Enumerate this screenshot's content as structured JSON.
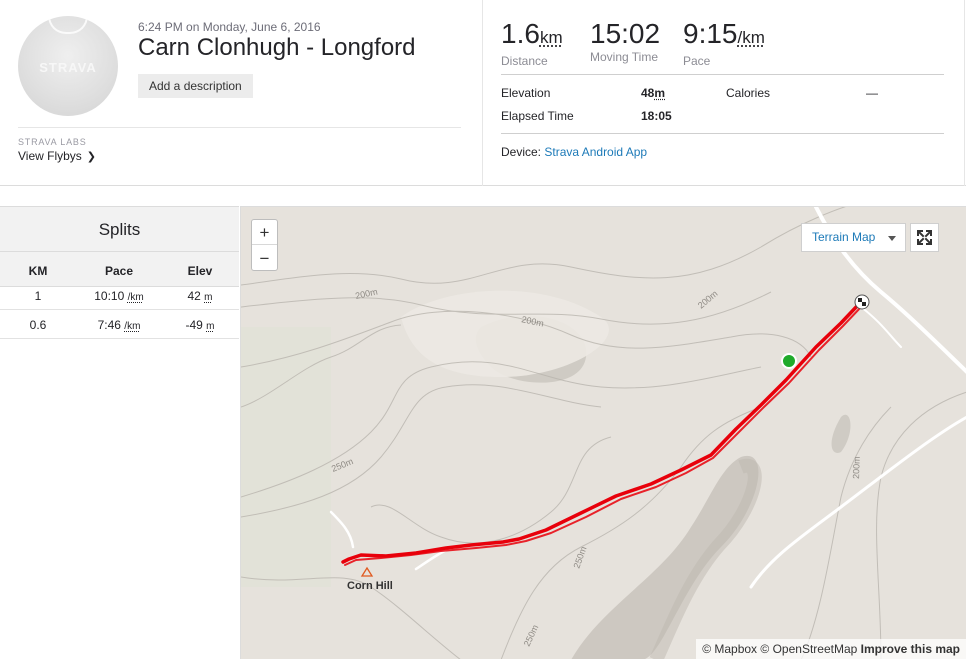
{
  "activity": {
    "date_line": "6:24 PM on Monday, June 6, 2016",
    "title": "Carn Clonhugh - Longford",
    "add_description_label": "Add a description",
    "avatar_logo": "STRAVA"
  },
  "labs": {
    "label": "STRAVA LABS",
    "flyby_link": "View Flybys"
  },
  "stats": {
    "distance": {
      "value": "1.6",
      "unit": "km",
      "label": "Distance"
    },
    "moving_time": {
      "value": "15:02",
      "label": "Moving Time"
    },
    "pace": {
      "value": "9:15",
      "unit": "/km",
      "label": "Pace"
    }
  },
  "details": {
    "elevation_label": "Elevation",
    "elevation_value": "48",
    "elevation_unit": "m",
    "calories_label": "Calories",
    "calories_value": "—",
    "elapsed_label": "Elapsed Time",
    "elapsed_value": "18:05",
    "device_label": "Device: ",
    "device_value": "Strava Android App"
  },
  "splits": {
    "title": "Splits",
    "columns": [
      "KM",
      "Pace",
      "Elev"
    ],
    "rows": [
      {
        "km": "1",
        "pace": "10:10",
        "pace_unit": "/km",
        "elev": "42",
        "elev_unit": "m"
      },
      {
        "km": "0.6",
        "pace": "7:46",
        "pace_unit": "/km",
        "elev": "-49",
        "elev_unit": "m"
      }
    ]
  },
  "map": {
    "zoom_in": "+",
    "zoom_out": "−",
    "layer_label": "Terrain Map",
    "contour_labels": [
      "200m",
      "200m",
      "200m",
      "250m",
      "250m",
      "200m",
      "250m"
    ],
    "place_label": "Corn Hill",
    "attribution": {
      "mapbox": "© Mapbox",
      "osm": "© OpenStreetMap",
      "improve": "Improve this map"
    },
    "colors": {
      "route": "#e8000b",
      "start": "#1faa2a",
      "terrain": "#e6e2dc",
      "link": "#1d7ab8"
    }
  }
}
